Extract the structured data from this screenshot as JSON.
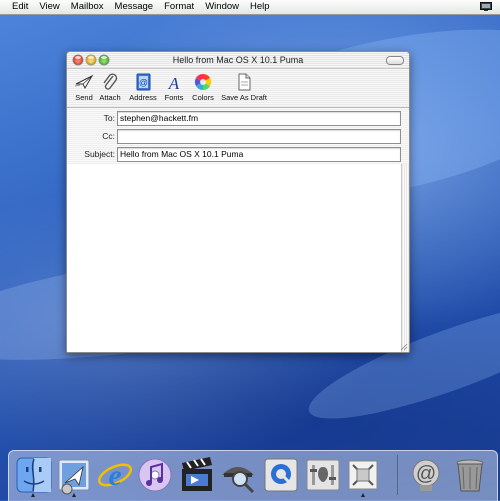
{
  "menubar": {
    "items": [
      "Edit",
      "View",
      "Mailbox",
      "Message",
      "Format",
      "Window",
      "Help"
    ]
  },
  "window": {
    "title": "Hello from Mac OS X 10.1 Puma",
    "toolbar": {
      "send": "Send",
      "attach": "Attach",
      "address": "Address",
      "fonts": "Fonts",
      "colors": "Colors",
      "save_draft": "Save As Draft"
    },
    "fields": {
      "to_label": "To:",
      "to_value": "stephen@hackett.fm",
      "cc_label": "Cc:",
      "cc_value": "",
      "subject_label": "Subject:",
      "subject_value": "Hello from Mac OS X 10.1 Puma"
    },
    "body": ""
  },
  "dock": {
    "items": [
      "finder-icon",
      "mail-icon",
      "internet-explorer-icon",
      "itunes-icon",
      "imovie-icon",
      "sherlock-icon",
      "quicktime-icon",
      "system-preferences-icon",
      "app-icon",
      "url-at-icon",
      "trash-icon"
    ]
  },
  "colors": {
    "desktop_blue": "#2f63c0",
    "menubar_bg": "#f0f0f0",
    "window_bg": "#ffffff"
  }
}
